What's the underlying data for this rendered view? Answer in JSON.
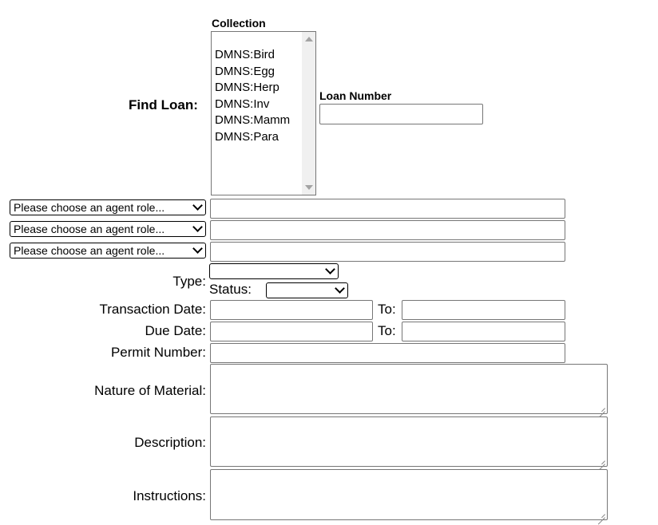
{
  "find_loan": {
    "label": "Find Loan:",
    "collection": {
      "label": "Collection",
      "options": [
        "DMNS:Bird",
        "DMNS:Egg",
        "DMNS:Herp",
        "DMNS:Inv",
        "DMNS:Mamm",
        "DMNS:Para"
      ]
    },
    "loan_number": {
      "label": "Loan Number",
      "value": ""
    }
  },
  "agent_rows": [
    {
      "role_selected": "Please choose an agent role...",
      "name_value": ""
    },
    {
      "role_selected": "Please choose an agent role...",
      "name_value": ""
    },
    {
      "role_selected": "Please choose an agent role...",
      "name_value": ""
    }
  ],
  "type": {
    "label": "Type:",
    "selected": ""
  },
  "status": {
    "label": "Status:",
    "selected": ""
  },
  "transaction_date": {
    "label": "Transaction Date:",
    "from": "",
    "to_label": "To:",
    "to": ""
  },
  "due_date": {
    "label": "Due Date:",
    "from": "",
    "to_label": "To:",
    "to": ""
  },
  "permit_number": {
    "label": "Permit Number:",
    "value": ""
  },
  "nature_of_material": {
    "label": "Nature of Material:",
    "value": ""
  },
  "description": {
    "label": "Description:",
    "value": ""
  },
  "instructions": {
    "label": "Instructions:",
    "value": ""
  }
}
